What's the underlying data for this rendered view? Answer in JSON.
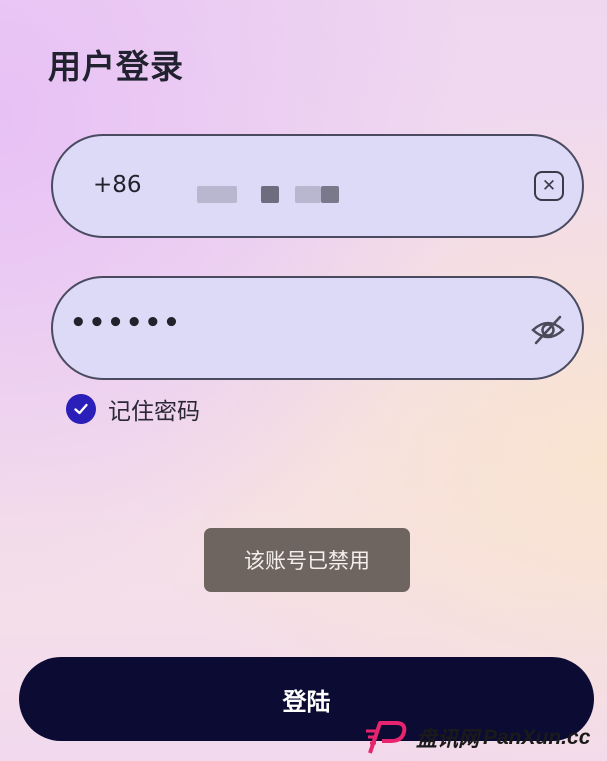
{
  "header": {
    "title": "用户登录"
  },
  "phone_field": {
    "prefix": "+86",
    "clear_icon": "close-square-icon"
  },
  "password_field": {
    "masked_value": "••••••",
    "toggle_icon": "eye-off-icon"
  },
  "remember": {
    "label": "记住密码",
    "checked": true,
    "icon": "check-circle-icon"
  },
  "toast": {
    "message": "该账号已禁用"
  },
  "login_button": {
    "label": "登陆"
  },
  "watermark": {
    "cn": "盘讯网",
    "en": "PanXun.cc",
    "logo": "p-logo-icon"
  },
  "colors": {
    "field_bg": "#dcdaf7",
    "accent": "#2a1fb8",
    "button_bg": "#0b0b33",
    "toast_bg": "#6f6560",
    "logo": "#e8246e"
  }
}
